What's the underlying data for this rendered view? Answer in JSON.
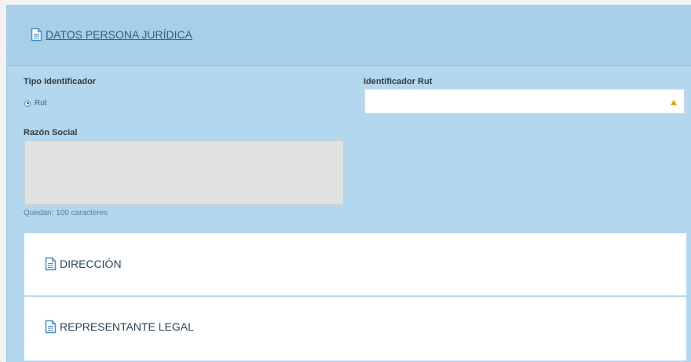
{
  "header": {
    "title": "DATOS PERSONA JURÍDICA",
    "icon": "document-icon"
  },
  "form": {
    "tipo_identificador_label": "Tipo Identificador",
    "radio_option": "Rut",
    "identificador_rut_label": "Identificador Rut",
    "identificador_rut_value": "",
    "razon_social_label": "Razón Social",
    "razon_social_value": "",
    "counter_text": "Quedan: 100 caracteres"
  },
  "sections": {
    "direccion": "DIRECCIÓN",
    "representante": "REPRESENTANTE LEGAL"
  },
  "colors": {
    "panel_bg": "#b3d7ec",
    "header_bg": "#a7cfe7",
    "header_text": "#2d5d86",
    "warning": "#e8a20b",
    "icon_blue": "#4b8fc7"
  }
}
